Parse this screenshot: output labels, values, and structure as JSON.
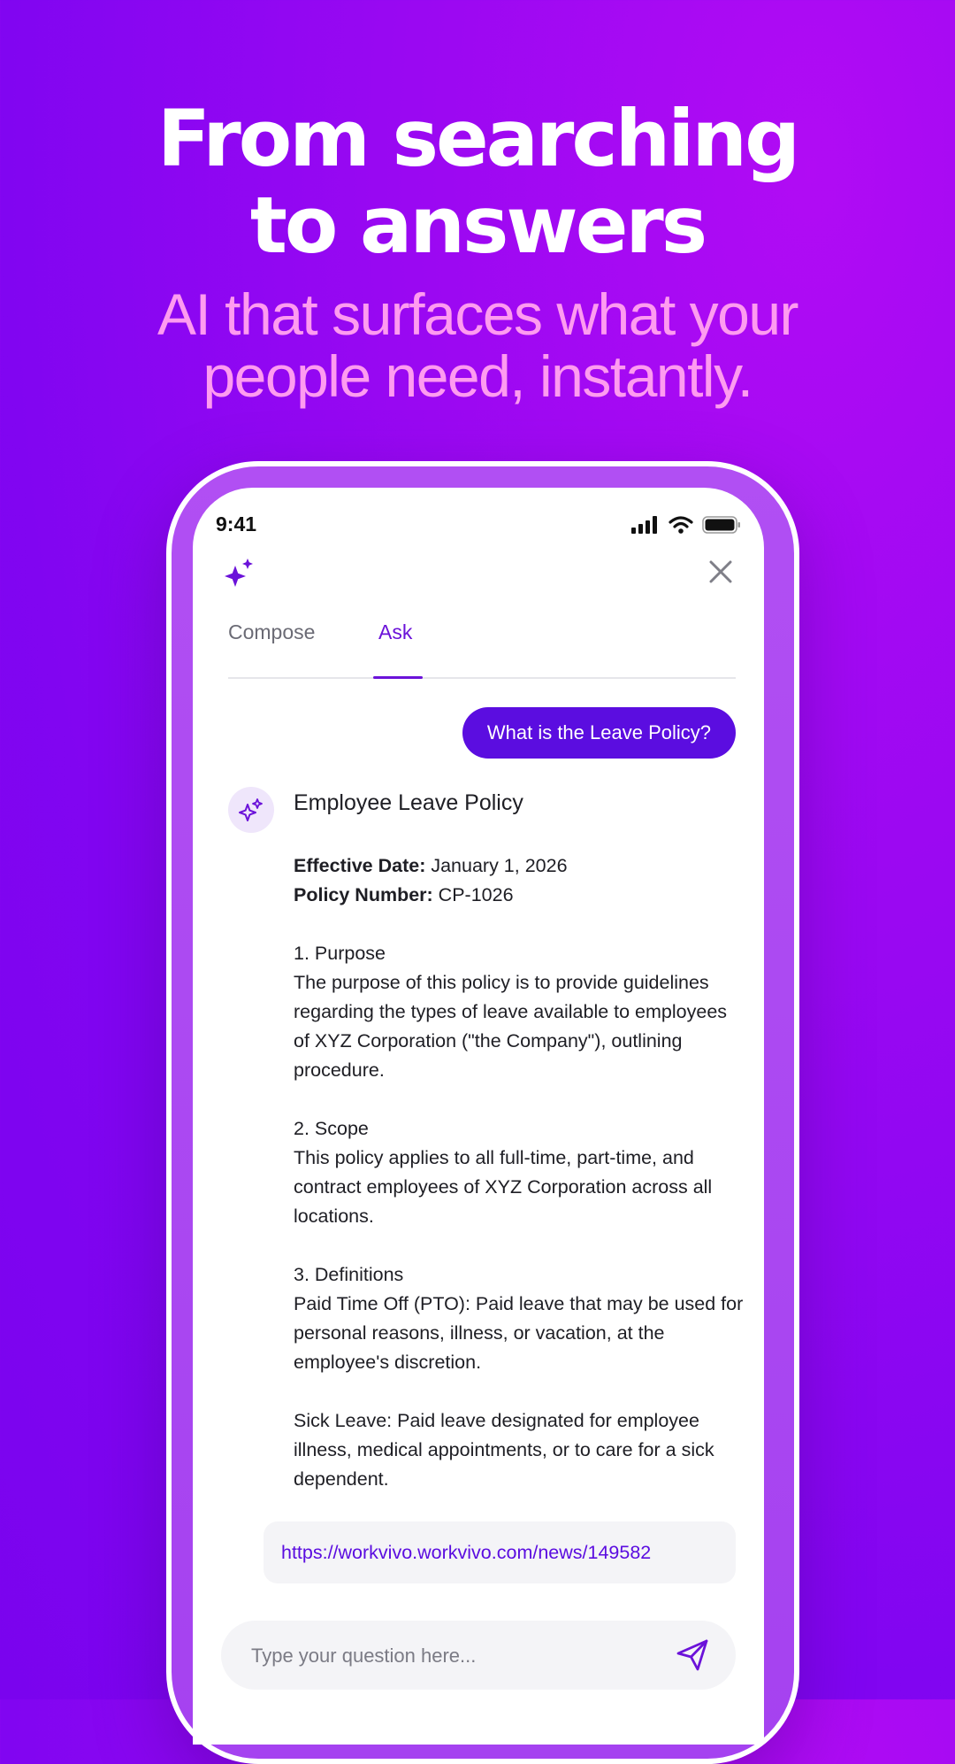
{
  "hero": {
    "title_line1": "From searching",
    "title_line2": "to answers",
    "subtitle_line1": "AI that surfaces what your",
    "subtitle_line2": "people need, instantly."
  },
  "status_bar": {
    "time": "9:41"
  },
  "header": {
    "ai_icon": "sparkle-icon",
    "close_icon": "close-icon"
  },
  "tabs": [
    {
      "label": "Compose",
      "active": false
    },
    {
      "label": "Ask",
      "active": true
    }
  ],
  "conversation": {
    "user_question": "What is the Leave Policy?",
    "answer": {
      "title": "Employee Leave Policy",
      "effective_label": "Effective Date:",
      "effective_value": " January 1, 2026",
      "policy_label": "Policy Number:",
      "policy_value": " CP-1026",
      "purpose_heading": "1. Purpose",
      "purpose_text": "The purpose of this policy is to provide guidelines regarding the types of leave available to employees of XYZ Corporation (\"the Company\"), outlining procedure.",
      "scope_heading": "2. Scope",
      "scope_text": "This policy applies to all full-time, part-time, and contract employees of XYZ Corporation across all locations.",
      "definitions_heading": "3. Definitions",
      "pto_text": "Paid Time Off (PTO): Paid leave that may be used for personal reasons, illness, or vacation, at the employee's discretion.",
      "sick_text": "Sick Leave: Paid leave designated for employee illness, medical appointments, or to care for a sick dependent."
    },
    "source_link": "https://workvivo.workvivo.com/news/149582"
  },
  "composer": {
    "placeholder": "Type your question here...",
    "send_icon": "send-icon"
  },
  "colors": {
    "brand": "#5b0de0",
    "accent_pink": "#ff9bf0",
    "background": "#8105f1"
  }
}
